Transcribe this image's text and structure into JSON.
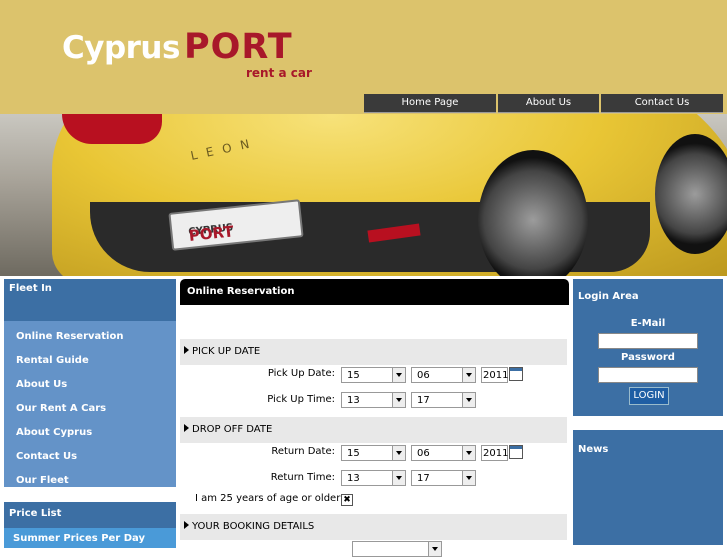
{
  "brand": {
    "name_white": "Cyprus",
    "name_red": "PORT",
    "tagline": "rent a car",
    "plate_small": "CYPRUS",
    "plate_big": "PORT",
    "model": "LEON",
    "color_accent": "#a8182a",
    "color_header": "#dcc36c"
  },
  "nav": [
    {
      "label": "Home Page"
    },
    {
      "label": "About Us"
    },
    {
      "label": "Contact Us"
    }
  ],
  "sidebar": {
    "fleet_title": "Fleet In",
    "items": [
      {
        "label": "Online Reservation"
      },
      {
        "label": "Rental Guide"
      },
      {
        "label": "About Us"
      },
      {
        "label": "Our Rent A Cars"
      },
      {
        "label": "About Cyprus"
      },
      {
        "label": "Contact Us"
      },
      {
        "label": "Our Fleet"
      }
    ],
    "price_title": "Price List",
    "price_item": "Summer Prices Per Day"
  },
  "reservation": {
    "title": "Online Reservation",
    "pickup": {
      "section": "PICK UP DATE",
      "date_label": "Pick Up Date:",
      "time_label": "Pick Up Time:",
      "day": "15",
      "month": "06",
      "year": "2011",
      "hour": "13",
      "minute": "17"
    },
    "dropoff": {
      "section": "DROP OFF DATE",
      "date_label": "Return Date:",
      "time_label": "Return Time:",
      "day": "15",
      "month": "06",
      "year": "2011",
      "hour": "13",
      "minute": "17"
    },
    "age_label": "I am 25 years of age or older:",
    "age_checked": "✖",
    "booking_section": "YOUR BOOKING DETAILS"
  },
  "login": {
    "title": "Login Area",
    "email_label": "E-Mail",
    "password_label": "Password",
    "button": "LOGIN"
  },
  "news": {
    "title": "News"
  },
  "icons": [
    "calendar-icon",
    "dropdown-arrow-icon",
    "section-arrow-icon"
  ]
}
